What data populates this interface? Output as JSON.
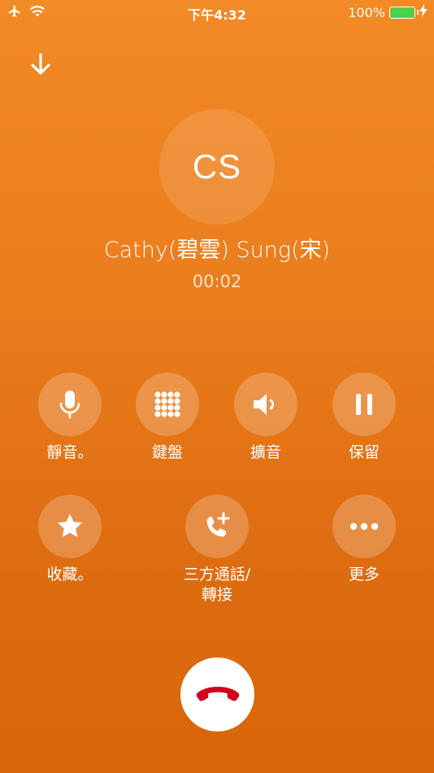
{
  "status_bar": {
    "time": "下午4:32",
    "battery": "100%"
  },
  "caller": {
    "initials": "CS",
    "name": "Cathy(碧雲) Sung(宋)",
    "duration": "00:02"
  },
  "controls": {
    "mute": "靜音。",
    "keypad": "鍵盤",
    "speaker": "擴音",
    "hold": "保留",
    "favorite": "收藏。",
    "add_call_line1": "三方通話/",
    "add_call_line2": "轉接",
    "more": "更多"
  },
  "colors": {
    "accent": "#E8791B",
    "end_call_icon": "#D0021B",
    "battery": "#46D34A"
  }
}
